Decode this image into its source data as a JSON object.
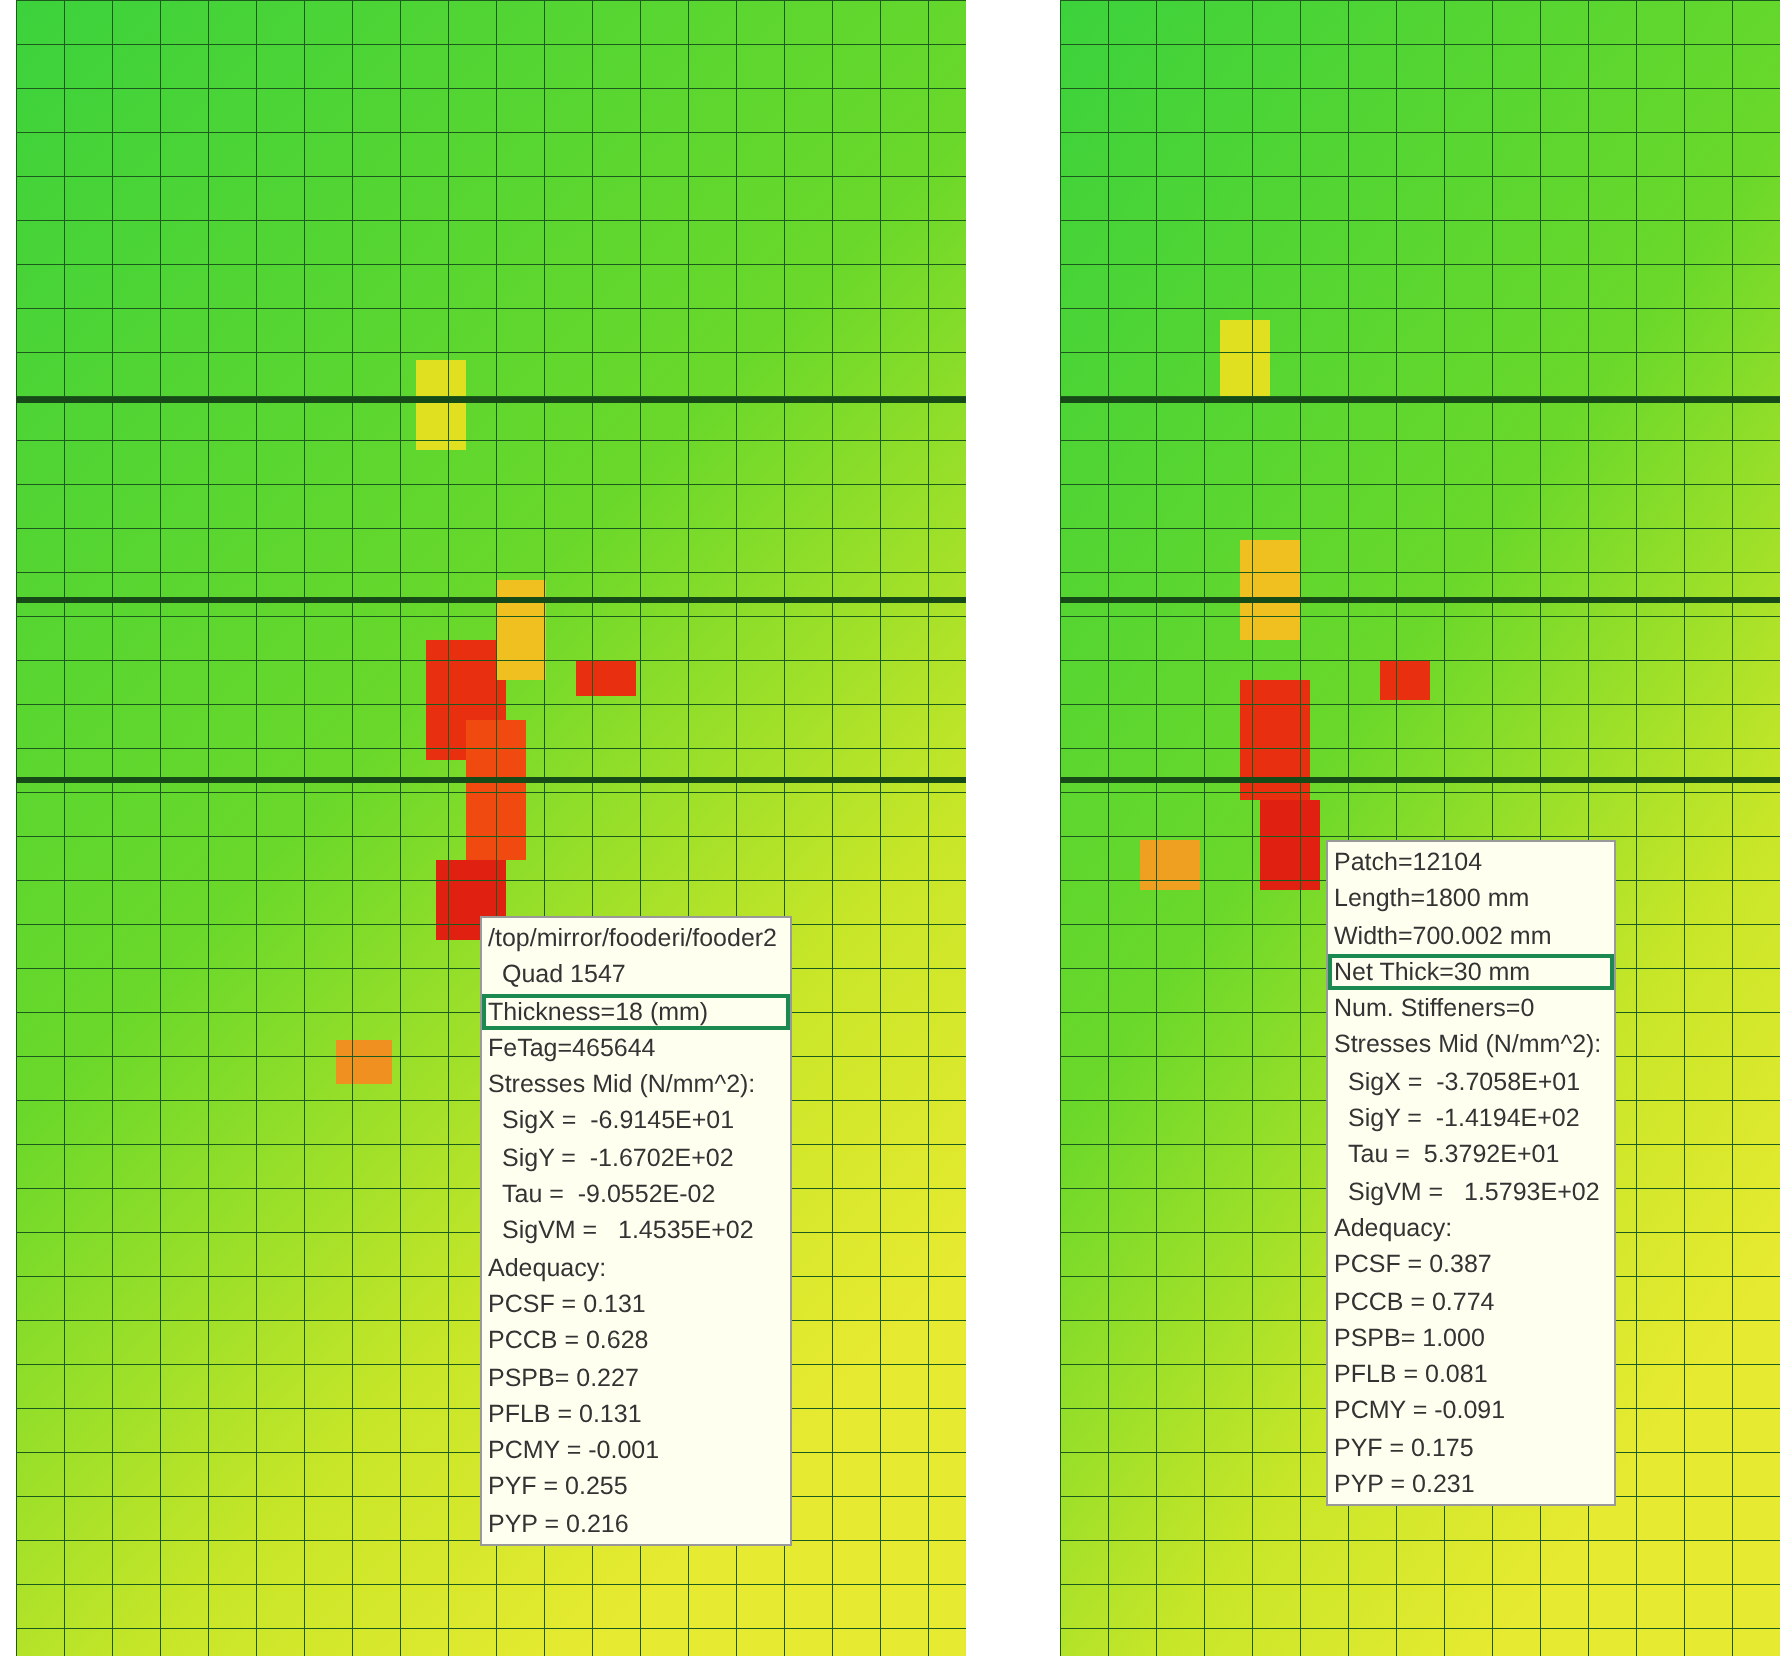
{
  "panels": [
    {
      "tooltip": {
        "lines": [
          {
            "text": "/top/mirror/fooderi/fooder2",
            "indented": false,
            "highlighted": false
          },
          {
            "text": "Quad 1547",
            "indented": true,
            "highlighted": false
          },
          {
            "text": "Thickness=18 (mm)",
            "indented": false,
            "highlighted": true
          },
          {
            "text": "FeTag=465644",
            "indented": false,
            "highlighted": false
          },
          {
            "text": "Stresses Mid (N/mm^2):",
            "indented": false,
            "highlighted": false
          },
          {
            "text": "SigX =  -6.9145E+01",
            "indented": true,
            "highlighted": false
          },
          {
            "text": "SigY =  -1.6702E+02",
            "indented": true,
            "highlighted": false
          },
          {
            "text": "Tau =  -9.0552E-02",
            "indented": true,
            "highlighted": false
          },
          {
            "text": "SigVM =   1.4535E+02",
            "indented": true,
            "highlighted": false
          },
          {
            "text": "Adequacy:",
            "indented": false,
            "highlighted": false
          },
          {
            "text": "PCSF = 0.131",
            "indented": false,
            "highlighted": false
          },
          {
            "text": "PCCB = 0.628",
            "indented": false,
            "highlighted": false
          },
          {
            "text": "PSPB= 0.227",
            "indented": false,
            "highlighted": false
          },
          {
            "text": "PFLB = 0.131",
            "indented": false,
            "highlighted": false
          },
          {
            "text": "PCMY = -0.001",
            "indented": false,
            "highlighted": false
          },
          {
            "text": "PYF = 0.255",
            "indented": false,
            "highlighted": false
          },
          {
            "text": "PYP = 0.216",
            "indented": false,
            "highlighted": false
          }
        ]
      }
    },
    {
      "tooltip": {
        "lines": [
          {
            "text": "Patch=12104",
            "indented": false,
            "highlighted": false
          },
          {
            "text": "Length=1800 mm",
            "indented": false,
            "highlighted": false
          },
          {
            "text": "Width=700.002 mm",
            "indented": false,
            "highlighted": false
          },
          {
            "text": "Net Thick=30 mm",
            "indented": false,
            "highlighted": true
          },
          {
            "text": "Num. Stiffeners=0",
            "indented": false,
            "highlighted": false
          },
          {
            "text": "Stresses Mid (N/mm^2):",
            "indented": false,
            "highlighted": false
          },
          {
            "text": "SigX =  -3.7058E+01",
            "indented": true,
            "highlighted": false
          },
          {
            "text": "SigY =  -1.4194E+02",
            "indented": true,
            "highlighted": false
          },
          {
            "text": "Tau =  5.3792E+01",
            "indented": true,
            "highlighted": false
          },
          {
            "text": "SigVM =   1.5793E+02",
            "indented": true,
            "highlighted": false
          },
          {
            "text": "Adequacy:",
            "indented": false,
            "highlighted": false
          },
          {
            "text": "PCSF = 0.387",
            "indented": false,
            "highlighted": false
          },
          {
            "text": "PCCB = 0.774",
            "indented": false,
            "highlighted": false
          },
          {
            "text": "PSPB= 1.000",
            "indented": false,
            "highlighted": false
          },
          {
            "text": "PFLB = 0.081",
            "indented": false,
            "highlighted": false
          },
          {
            "text": "PCMY = -0.091",
            "indented": false,
            "highlighted": false
          },
          {
            "text": "PYF = 0.175",
            "indented": false,
            "highlighted": false
          },
          {
            "text": "PYP = 0.231",
            "indented": false,
            "highlighted": false
          }
        ]
      }
    }
  ]
}
